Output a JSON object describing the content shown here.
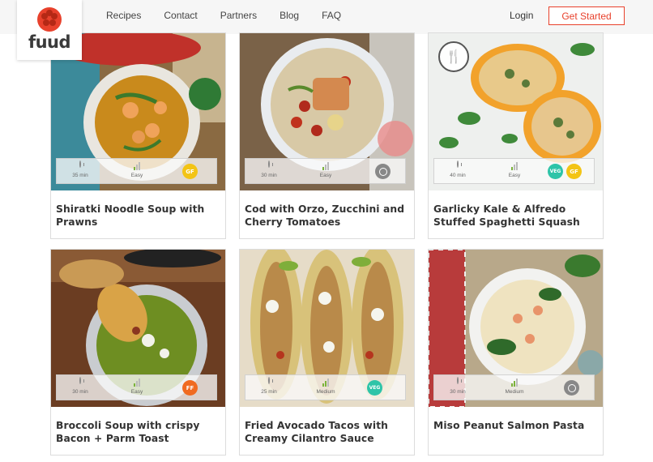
{
  "brand": {
    "name": "fuud"
  },
  "nav": {
    "items": [
      "Recipes",
      "Contact",
      "Partners",
      "Blog",
      "FAQ"
    ],
    "login": "Login",
    "cta": "Get Started"
  },
  "colors": {
    "accent": "#e8412c",
    "gf_badge": "#f3c415",
    "veg_badge": "#2ec4a8",
    "ff_badge": "#f06b21"
  },
  "recipes": [
    {
      "title": "Shiratki Noodle Soup with Prawns",
      "time": "35 min",
      "difficulty": "Easy",
      "difficulty_level": 1,
      "badges": [
        "GF"
      ]
    },
    {
      "title": "Cod with Orzo, Zucchini and Cherry Tomatoes",
      "time": "30 min",
      "difficulty": "Easy",
      "difficulty_level": 1,
      "badges": [
        "icon"
      ]
    },
    {
      "title": "Garlicky Kale & Alfredo Stuffed Spaghetti Squash",
      "time": "40 min",
      "difficulty": "Easy",
      "difficulty_level": 1,
      "badges": [
        "VEG",
        "GF"
      ]
    },
    {
      "title": "Broccoli Soup with crispy Bacon + Parm Toast",
      "time": "30 min",
      "difficulty": "Easy",
      "difficulty_level": 1,
      "badges": [
        "FF"
      ]
    },
    {
      "title": "Fried Avocado Tacos with Creamy Cilantro Sauce",
      "time": "25 min",
      "difficulty": "Medium",
      "difficulty_level": 2,
      "badges": [
        "VEG"
      ]
    },
    {
      "title": "Miso Peanut Salmon Pasta",
      "time": "30 min",
      "difficulty": "Medium",
      "difficulty_level": 2,
      "badges": [
        "icon"
      ]
    }
  ]
}
